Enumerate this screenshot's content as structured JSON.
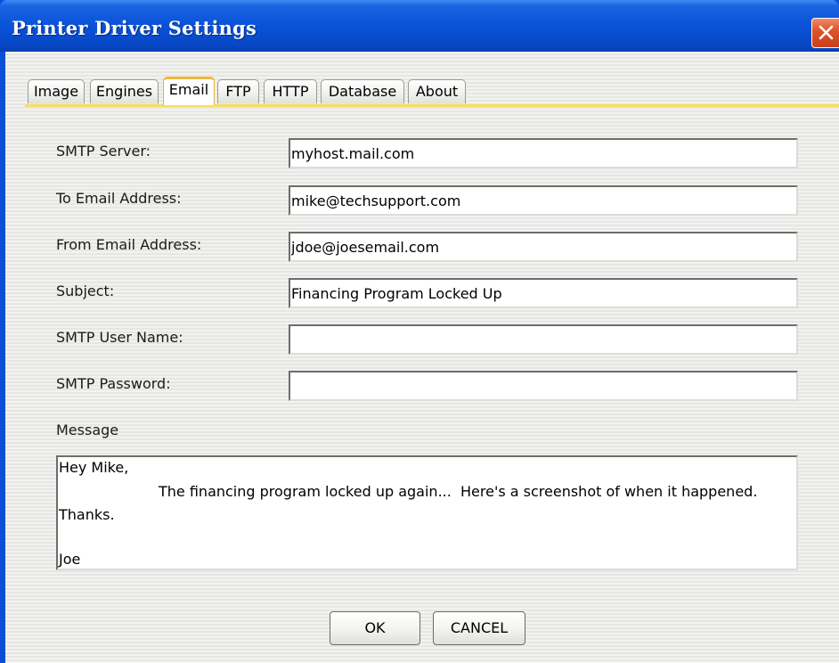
{
  "window": {
    "title": "Printer Driver Settings"
  },
  "tabs": [
    {
      "label": "Image",
      "active": false
    },
    {
      "label": "Engines",
      "active": false
    },
    {
      "label": "Email",
      "active": true
    },
    {
      "label": "FTP",
      "active": false
    },
    {
      "label": "HTTP",
      "active": false
    },
    {
      "label": "Database",
      "active": false
    },
    {
      "label": "About",
      "active": false
    }
  ],
  "email_form": {
    "smtp_server": {
      "label": "SMTP Server:",
      "value": "myhost.mail.com"
    },
    "to_address": {
      "label": "To Email Address:",
      "value": "mike@techsupport.com"
    },
    "from_address": {
      "label": "From Email Address:",
      "value": "jdoe@joesemail.com"
    },
    "subject": {
      "label": "Subject:",
      "value": "Financing Program Locked Up"
    },
    "smtp_user": {
      "label": "SMTP User Name:",
      "value": ""
    },
    "smtp_password": {
      "label": "SMTP Password:",
      "value": ""
    },
    "message": {
      "label": "Message",
      "lines": [
        "Hey Mike,",
        "The financing program locked up again...  Here's a screenshot of when it happened.",
        "Thanks.",
        "",
        "Joe"
      ]
    }
  },
  "buttons": {
    "ok": "OK",
    "cancel": "CANCEL"
  },
  "colors": {
    "titlebar": "#0a52d9",
    "close_button": "#e0522c",
    "active_tab_accent": "#f0b83a",
    "tab_underline": "#f6df5e"
  },
  "icons": {
    "close": "close-x-icon"
  }
}
